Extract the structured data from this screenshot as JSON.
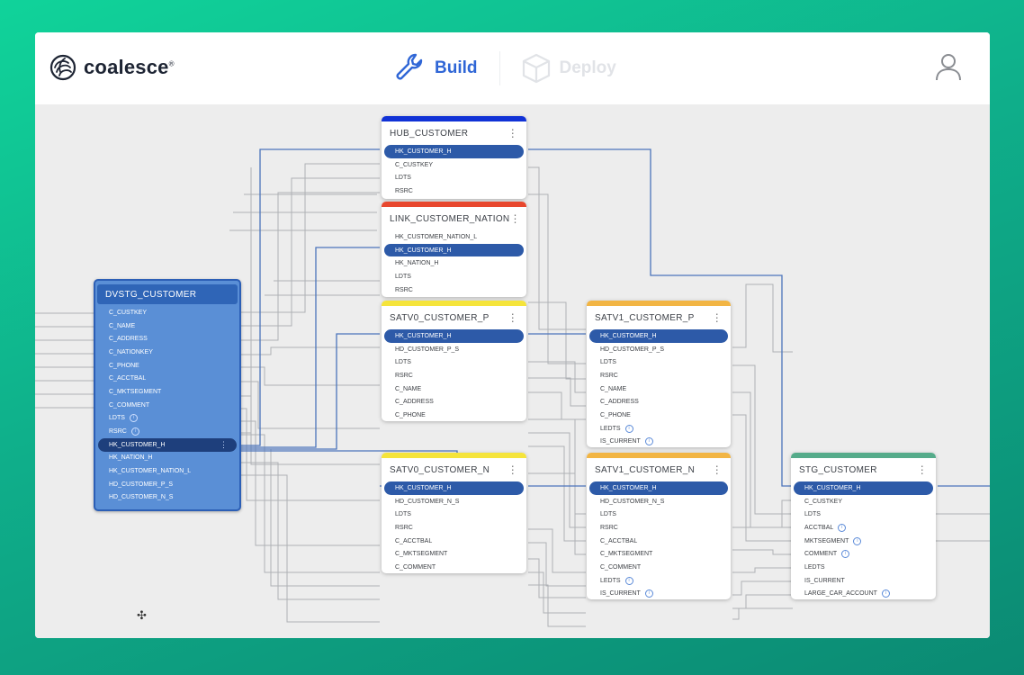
{
  "app": {
    "logo_text": "coalesce",
    "logo_mark": "®",
    "nav": {
      "build": "Build",
      "deploy": "Deploy"
    },
    "icons": {
      "build": "wrench-icon",
      "deploy": "cube-icon",
      "user": "user-icon",
      "logo": "coalesce-swirl-icon",
      "move": "move-icon"
    },
    "colors": {
      "accent": "#2f66d6",
      "hub": "#1132d6",
      "link": "#e8472e",
      "sat0": "#f5e43b",
      "sat1": "#f2b544",
      "stg": "#55ab8a",
      "dvstg": "#5a8fd6"
    }
  },
  "nodes": {
    "dvstg": {
      "title": "DVSTG_CUSTOMER",
      "rows": [
        {
          "label": "C_CUSTKEY"
        },
        {
          "label": "C_NAME"
        },
        {
          "label": "C_ADDRESS"
        },
        {
          "label": "C_NATIONKEY"
        },
        {
          "label": "C_PHONE"
        },
        {
          "label": "C_ACCTBAL"
        },
        {
          "label": "C_MKTSEGMENT"
        },
        {
          "label": "C_COMMENT"
        },
        {
          "label": "LDTS",
          "info": true
        },
        {
          "label": "RSRC",
          "info": true
        },
        {
          "label": "HK_CUSTOMER_H",
          "hl": true
        },
        {
          "label": "HK_NATION_H"
        },
        {
          "label": "HK_CUSTOMER_NATION_L"
        },
        {
          "label": "HD_CUSTOMER_P_S"
        },
        {
          "label": "HD_CUSTOMER_N_S"
        }
      ]
    },
    "hub": {
      "title": "HUB_CUSTOMER",
      "rows": [
        {
          "label": "HK_CUSTOMER_H",
          "hl": true
        },
        {
          "label": "C_CUSTKEY"
        },
        {
          "label": "LDTS"
        },
        {
          "label": "RSRC"
        }
      ]
    },
    "link": {
      "title": "LINK_CUSTOMER_NATION",
      "rows": [
        {
          "label": "HK_CUSTOMER_NATION_L"
        },
        {
          "label": "HK_CUSTOMER_H",
          "hl": true
        },
        {
          "label": "HK_NATION_H"
        },
        {
          "label": "LDTS"
        },
        {
          "label": "RSRC"
        }
      ]
    },
    "sat0p": {
      "title": "SATV0_CUSTOMER_P",
      "rows": [
        {
          "label": "HK_CUSTOMER_H",
          "hl": true
        },
        {
          "label": "HD_CUSTOMER_P_S"
        },
        {
          "label": "LDTS"
        },
        {
          "label": "RSRC"
        },
        {
          "label": "C_NAME"
        },
        {
          "label": "C_ADDRESS"
        },
        {
          "label": "C_PHONE"
        }
      ]
    },
    "sat0n": {
      "title": "SATV0_CUSTOMER_N",
      "rows": [
        {
          "label": "HK_CUSTOMER_H",
          "hl": true
        },
        {
          "label": "HD_CUSTOMER_N_S"
        },
        {
          "label": "LDTS"
        },
        {
          "label": "RSRC"
        },
        {
          "label": "C_ACCTBAL"
        },
        {
          "label": "C_MKTSEGMENT"
        },
        {
          "label": "C_COMMENT"
        }
      ]
    },
    "sat1p": {
      "title": "SATV1_CUSTOMER_P",
      "rows": [
        {
          "label": "HK_CUSTOMER_H",
          "hl": true
        },
        {
          "label": "HD_CUSTOMER_P_S"
        },
        {
          "label": "LDTS"
        },
        {
          "label": "RSRC"
        },
        {
          "label": "C_NAME"
        },
        {
          "label": "C_ADDRESS"
        },
        {
          "label": "C_PHONE"
        },
        {
          "label": "LEDTS",
          "info": true
        },
        {
          "label": "IS_CURRENT",
          "info": true
        }
      ]
    },
    "sat1n": {
      "title": "SATV1_CUSTOMER_N",
      "rows": [
        {
          "label": "HK_CUSTOMER_H",
          "hl": true
        },
        {
          "label": "HD_CUSTOMER_N_S"
        },
        {
          "label": "LDTS"
        },
        {
          "label": "RSRC"
        },
        {
          "label": "C_ACCTBAL"
        },
        {
          "label": "C_MKTSEGMENT"
        },
        {
          "label": "C_COMMENT"
        },
        {
          "label": "LEDTS",
          "info": true
        },
        {
          "label": "IS_CURRENT",
          "info": true
        }
      ]
    },
    "stg": {
      "title": "STG_CUSTOMER",
      "rows": [
        {
          "label": "HK_CUSTOMER_H",
          "hl": true
        },
        {
          "label": "C_CUSTKEY"
        },
        {
          "label": "LDTS"
        },
        {
          "label": "ACCTBAL",
          "info": true
        },
        {
          "label": "MKTSEGMENT",
          "info": true
        },
        {
          "label": "COMMENT",
          "info": true
        },
        {
          "label": "LEDTS"
        },
        {
          "label": "IS_CURRENT"
        },
        {
          "label": "LARGE_CAR_ACCOUNT",
          "info": true
        }
      ]
    }
  }
}
